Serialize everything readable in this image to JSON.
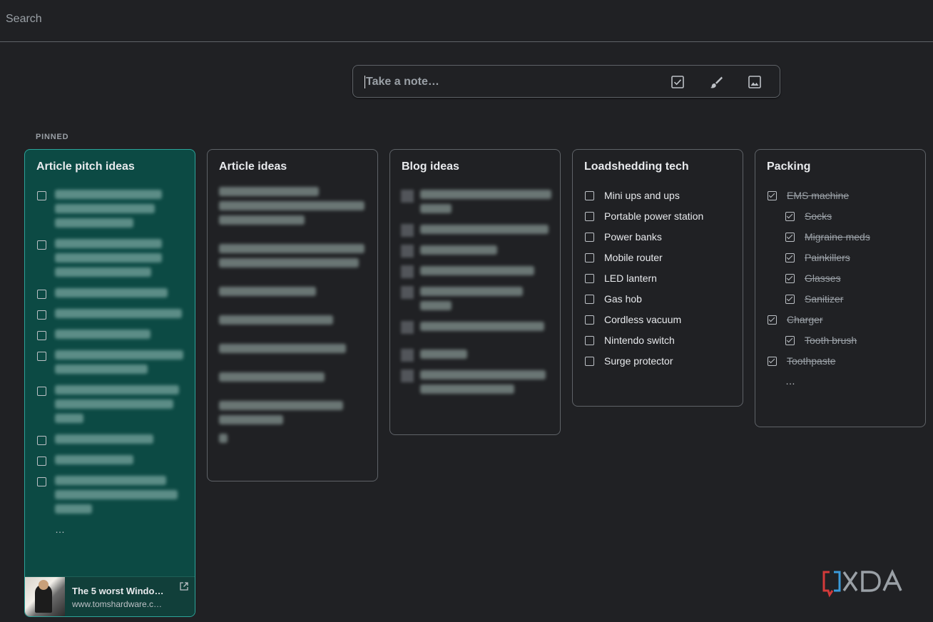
{
  "search": {
    "placeholder": "Search"
  },
  "take_note": {
    "placeholder": "Take a note…"
  },
  "pinned_label": "PINNED",
  "notes": [
    {
      "title": "Article pitch ideas",
      "color": "#0c4a44",
      "more": "…",
      "link": {
        "title": "The 5 worst Windo…",
        "url": "www.tomshardware.c…"
      }
    },
    {
      "title": "Article ideas"
    },
    {
      "title": "Blog ideas"
    },
    {
      "title": "Loadshedding tech",
      "items": [
        "Mini ups and ups",
        "Portable power station",
        "Power banks",
        "Mobile router",
        "LED lantern",
        "Gas hob",
        "Cordless vacuum",
        "Nintendo switch",
        "Surge protector"
      ]
    },
    {
      "title": "Packing",
      "items": [
        "EMS machine",
        "Socks",
        "Migraine meds",
        "Painkillers",
        "Glasses",
        "Sanitizer",
        "Charger",
        "Tooth brush",
        "Toothpaste"
      ],
      "more": "…"
    }
  ],
  "colors": {
    "background": "#202124",
    "card_border": "#5f6368",
    "teal_note": "#0c4a44",
    "teal_border": "#2ca49a"
  },
  "icons": [
    "checkbox-icon",
    "brush-icon",
    "image-icon",
    "open-in-new-icon"
  ],
  "watermark": "XDA"
}
